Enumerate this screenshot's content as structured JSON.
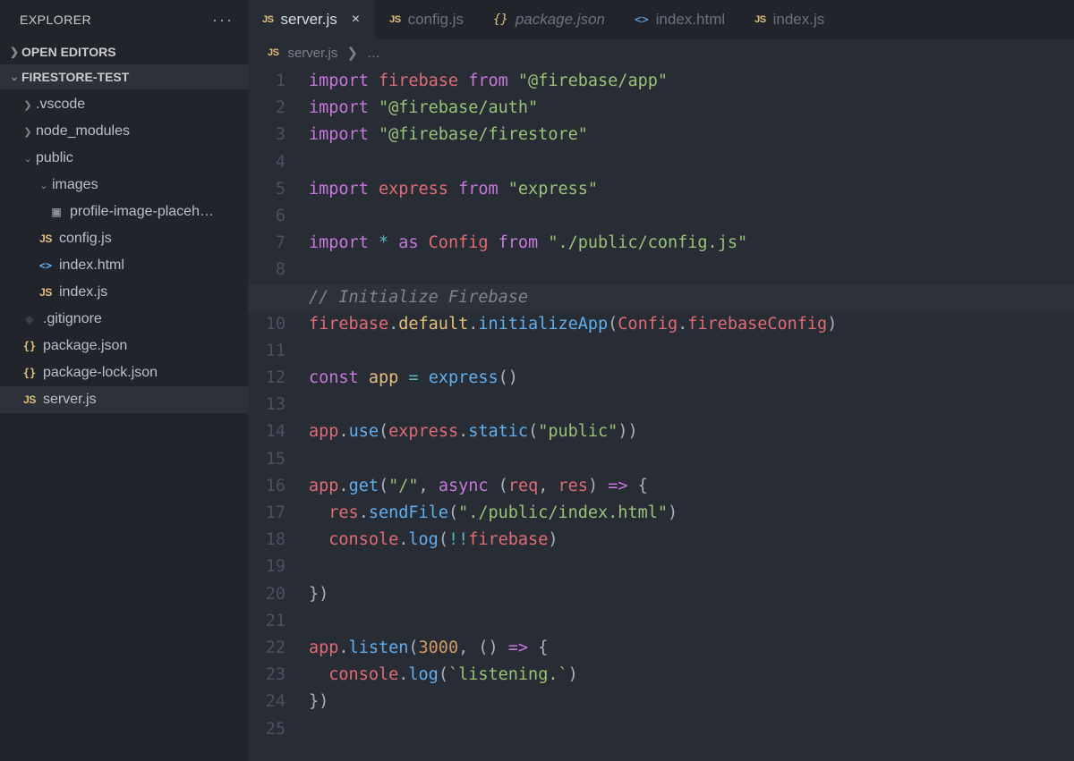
{
  "sidebar": {
    "title": "EXPLORER",
    "sections": {
      "open_editors": "OPEN EDITORS",
      "project": "FIRESTORE-TEST"
    },
    "tree": [
      {
        "label": ".vscode",
        "type": "folder",
        "indent": 1,
        "open": false
      },
      {
        "label": "node_modules",
        "type": "folder",
        "indent": 1,
        "open": false
      },
      {
        "label": "public",
        "type": "folder",
        "indent": 1,
        "open": true
      },
      {
        "label": "images",
        "type": "folder",
        "indent": 2,
        "open": true
      },
      {
        "label": "profile-image-placeh…",
        "type": "image",
        "indent": 3
      },
      {
        "label": "config.js",
        "type": "js",
        "indent": 2
      },
      {
        "label": "index.html",
        "type": "html",
        "indent": 2
      },
      {
        "label": "index.js",
        "type": "js",
        "indent": 2
      },
      {
        "label": ".gitignore",
        "type": "git",
        "indent": 1
      },
      {
        "label": "package.json",
        "type": "json",
        "indent": 1
      },
      {
        "label": "package-lock.json",
        "type": "json",
        "indent": 1
      },
      {
        "label": "server.js",
        "type": "js",
        "indent": 1,
        "active": true
      }
    ]
  },
  "tabs": [
    {
      "label": "server.js",
      "type": "js",
      "active": true,
      "close": true
    },
    {
      "label": "config.js",
      "type": "js"
    },
    {
      "label": "package.json",
      "type": "json",
      "italic": true
    },
    {
      "label": "index.html",
      "type": "html"
    },
    {
      "label": "index.js",
      "type": "js"
    }
  ],
  "breadcrumb": {
    "file": "server.js",
    "rest": "…"
  },
  "code": {
    "highlight_line": 9,
    "lines": [
      [
        [
          "k",
          "import"
        ],
        [
          "p",
          " "
        ],
        [
          "v",
          "firebase"
        ],
        [
          "p",
          " "
        ],
        [
          "k",
          "from"
        ],
        [
          "p",
          " "
        ],
        [
          "s",
          "\"@firebase/app\""
        ]
      ],
      [
        [
          "k",
          "import"
        ],
        [
          "p",
          " "
        ],
        [
          "s",
          "\"@firebase/auth\""
        ]
      ],
      [
        [
          "k",
          "import"
        ],
        [
          "p",
          " "
        ],
        [
          "s",
          "\"@firebase/firestore\""
        ]
      ],
      [],
      [
        [
          "k",
          "import"
        ],
        [
          "p",
          " "
        ],
        [
          "v",
          "express"
        ],
        [
          "p",
          " "
        ],
        [
          "k",
          "from"
        ],
        [
          "p",
          " "
        ],
        [
          "s",
          "\"express\""
        ]
      ],
      [],
      [
        [
          "k",
          "import"
        ],
        [
          "p",
          " "
        ],
        [
          "t",
          "*"
        ],
        [
          "p",
          " "
        ],
        [
          "k",
          "as"
        ],
        [
          "p",
          " "
        ],
        [
          "v",
          "Config"
        ],
        [
          "p",
          " "
        ],
        [
          "k",
          "from"
        ],
        [
          "p",
          " "
        ],
        [
          "s",
          "\"./public/config.js\""
        ]
      ],
      [],
      [
        [
          "c",
          "// Initialize Firebase"
        ]
      ],
      [
        [
          "v",
          "firebase"
        ],
        [
          "p",
          "."
        ],
        [
          "y",
          "default"
        ],
        [
          "p",
          "."
        ],
        [
          "f",
          "initializeApp"
        ],
        [
          "p",
          "("
        ],
        [
          "v",
          "Config"
        ],
        [
          "p",
          "."
        ],
        [
          "v",
          "firebaseConfig"
        ],
        [
          "p",
          ")"
        ]
      ],
      [],
      [
        [
          "k",
          "const"
        ],
        [
          "p",
          " "
        ],
        [
          "y",
          "app"
        ],
        [
          "p",
          " "
        ],
        [
          "t",
          "="
        ],
        [
          "p",
          " "
        ],
        [
          "f",
          "express"
        ],
        [
          "p",
          "()"
        ]
      ],
      [],
      [
        [
          "v",
          "app"
        ],
        [
          "p",
          "."
        ],
        [
          "f",
          "use"
        ],
        [
          "p",
          "("
        ],
        [
          "v",
          "express"
        ],
        [
          "p",
          "."
        ],
        [
          "f",
          "static"
        ],
        [
          "p",
          "("
        ],
        [
          "s",
          "\"public\""
        ],
        [
          "p",
          "))"
        ]
      ],
      [],
      [
        [
          "v",
          "app"
        ],
        [
          "p",
          "."
        ],
        [
          "f",
          "get"
        ],
        [
          "p",
          "("
        ],
        [
          "s",
          "\"/\""
        ],
        [
          "p",
          ", "
        ],
        [
          "k",
          "async"
        ],
        [
          "p",
          " ("
        ],
        [
          "v",
          "req"
        ],
        [
          "p",
          ", "
        ],
        [
          "v",
          "res"
        ],
        [
          "p",
          ") "
        ],
        [
          "k",
          "=>"
        ],
        [
          "p",
          " {"
        ]
      ],
      [
        [
          "p",
          "  "
        ],
        [
          "v",
          "res"
        ],
        [
          "p",
          "."
        ],
        [
          "f",
          "sendFile"
        ],
        [
          "p",
          "("
        ],
        [
          "s",
          "\"./public/index.html\""
        ],
        [
          "p",
          ")"
        ]
      ],
      [
        [
          "p",
          "  "
        ],
        [
          "v",
          "console"
        ],
        [
          "p",
          "."
        ],
        [
          "f",
          "log"
        ],
        [
          "p",
          "("
        ],
        [
          "t",
          "!!"
        ],
        [
          "v",
          "firebase"
        ],
        [
          "p",
          ")"
        ]
      ],
      [],
      [
        [
          "p",
          "})"
        ]
      ],
      [],
      [
        [
          "v",
          "app"
        ],
        [
          "p",
          "."
        ],
        [
          "f",
          "listen"
        ],
        [
          "p",
          "("
        ],
        [
          "n",
          "3000"
        ],
        [
          "p",
          ", () "
        ],
        [
          "k",
          "=>"
        ],
        [
          "p",
          " {"
        ]
      ],
      [
        [
          "p",
          "  "
        ],
        [
          "v",
          "console"
        ],
        [
          "p",
          "."
        ],
        [
          "f",
          "log"
        ],
        [
          "p",
          "("
        ],
        [
          "s",
          "`listening.`"
        ],
        [
          "p",
          ")"
        ]
      ],
      [
        [
          "p",
          "})"
        ]
      ],
      []
    ]
  }
}
